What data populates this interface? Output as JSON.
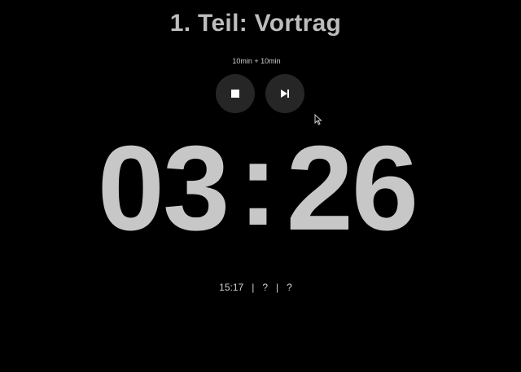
{
  "header": {
    "title": "1. Teil: Vortrag",
    "subtitle": "10min + 10min"
  },
  "controls": {
    "stop_icon": "stop-icon",
    "next_icon": "skip-next-icon"
  },
  "timer": {
    "minutes": "03",
    "separator": ":",
    "seconds": "26"
  },
  "footer": {
    "clock": "15:17",
    "separator": "|",
    "value_2": "?",
    "value_3": "?"
  },
  "colors": {
    "background": "#000000",
    "text": "#bdbdbd",
    "button_bg": "#262626"
  }
}
